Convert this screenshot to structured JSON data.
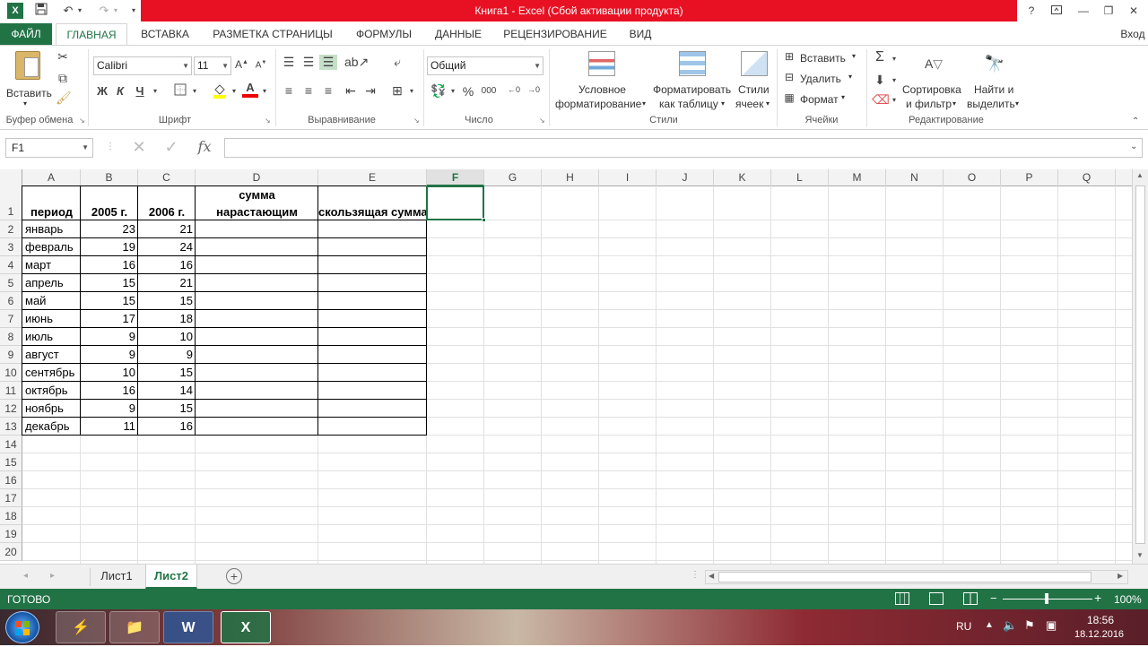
{
  "window": {
    "title": "Книга1 -  Excel (Сбой активации продукта)",
    "account": "Вход",
    "icons": [
      "excel-logo-icon",
      "save-icon",
      "undo-icon",
      "redo-icon",
      "customize-qat-icon",
      "help-icon",
      "ribbon-display-icon",
      "minimize-icon",
      "restore-icon",
      "close-icon"
    ]
  },
  "tabs": [
    "ФАЙЛ",
    "ГЛАВНАЯ",
    "ВСТАВКА",
    "РАЗМЕТКА СТРАНИЦЫ",
    "ФОРМУЛЫ",
    "ДАННЫЕ",
    "РЕЦЕНЗИРОВАНИЕ",
    "ВИД"
  ],
  "ribbon": {
    "clipboard": {
      "paste": "Вставить",
      "label": "Буфер обмена"
    },
    "font": {
      "name": "Calibri",
      "size": "11",
      "bold": "Ж",
      "italic": "К",
      "underline": "Ч",
      "label": "Шрифт"
    },
    "alignment": {
      "label": "Выравнивание"
    },
    "number": {
      "format": "Общий",
      "percent": "%",
      "thousands": "000",
      "label": "Число"
    },
    "styles": {
      "cond1": "Условное",
      "cond2": "форматирование",
      "table1": "Форматировать",
      "table2": "как таблицу",
      "cell1": "Стили",
      "cell2": "ячеек",
      "label": "Стили"
    },
    "cells": {
      "insert": "Вставить",
      "delete": "Удалить",
      "format": "Формат",
      "label": "Ячейки"
    },
    "editing": {
      "sort1": "Сортировка",
      "sort2": "и фильтр",
      "find1": "Найти и",
      "find2": "выделить",
      "label": "Редактирование"
    }
  },
  "formula_bar": {
    "name_box": "F1",
    "fx": "fx",
    "value": ""
  },
  "columns": [
    "A",
    "B",
    "C",
    "D",
    "E",
    "F",
    "G",
    "H",
    "I",
    "J",
    "K",
    "L",
    "M",
    "N",
    "O",
    "P",
    "Q"
  ],
  "selected_column": "F",
  "rows": [
    "1",
    "2",
    "3",
    "4",
    "5",
    "6",
    "7",
    "8",
    "9",
    "10",
    "11",
    "12",
    "13",
    "14",
    "15",
    "16",
    "17",
    "18",
    "19",
    "20"
  ],
  "table": {
    "headers": {
      "period": "период",
      "y2005": "2005 г.",
      "y2006": "2006 г.",
      "cumsum1": "сумма",
      "cumsum2": "нарастающим",
      "moving": "скользящая сумма"
    },
    "data": [
      [
        "январь",
        "23",
        "21"
      ],
      [
        "февраль",
        "19",
        "24"
      ],
      [
        "март",
        "16",
        "16"
      ],
      [
        "апрель",
        "15",
        "21"
      ],
      [
        "май",
        "15",
        "15"
      ],
      [
        "июнь",
        "17",
        "18"
      ],
      [
        "июль",
        "9",
        "10"
      ],
      [
        "август",
        "9",
        "9"
      ],
      [
        "сентябрь",
        "10",
        "15"
      ],
      [
        "октябрь",
        "16",
        "14"
      ],
      [
        "ноябрь",
        "9",
        "15"
      ],
      [
        "декабрь",
        "11",
        "16"
      ]
    ]
  },
  "sheets": [
    "Лист1",
    "Лист2"
  ],
  "active_sheet": "Лист2",
  "status": {
    "mode": "ГОТОВО",
    "zoom": "100%"
  },
  "taskbar": {
    "lang": "RU",
    "time": "18:56",
    "date": "18.12.2016"
  },
  "colors": {
    "excel_green": "#217346",
    "title_red": "#e81123"
  }
}
